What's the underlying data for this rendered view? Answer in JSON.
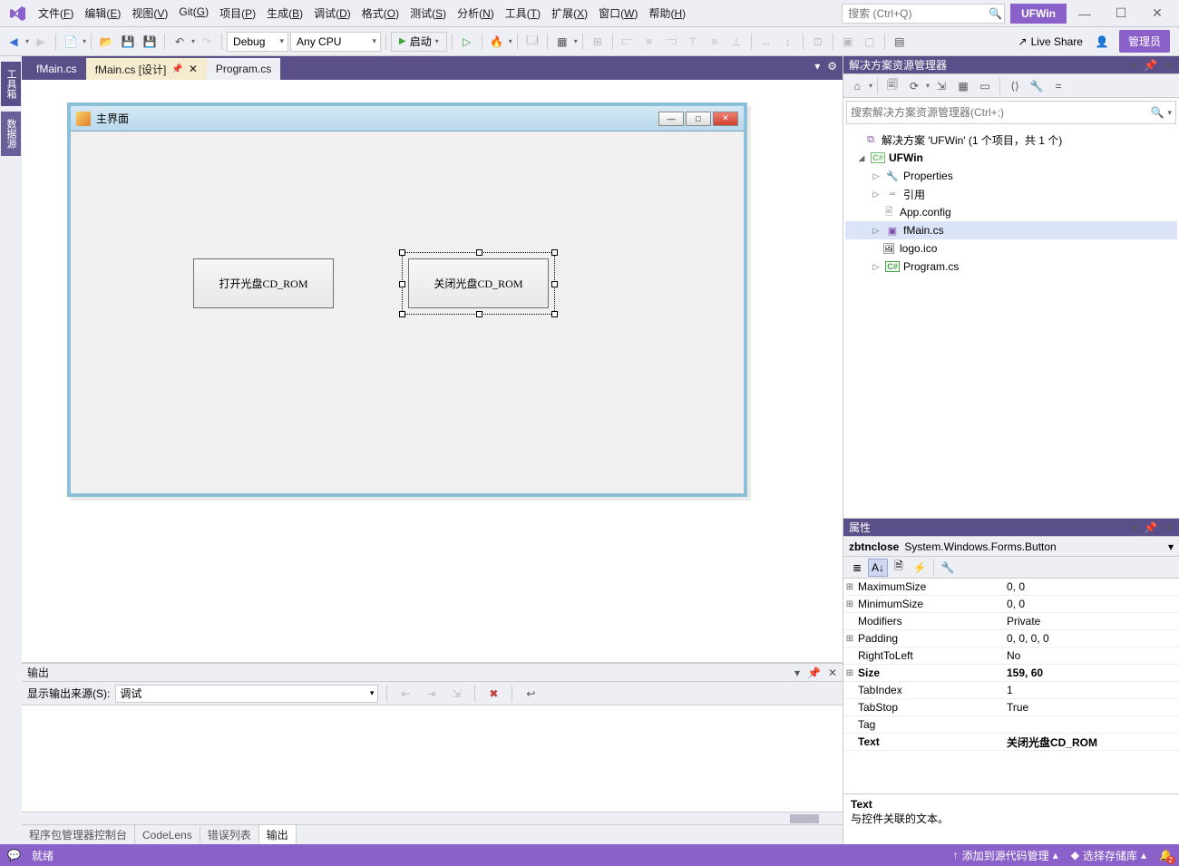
{
  "titlebar": {
    "menus": [
      "文件(F)",
      "编辑(E)",
      "视图(V)",
      "Git(G)",
      "项目(P)",
      "生成(B)",
      "调试(D)",
      "格式(O)",
      "测试(S)",
      "分析(N)",
      "工具(T)",
      "扩展(X)",
      "窗口(W)",
      "帮助(H)"
    ],
    "search_placeholder": "搜索 (Ctrl+Q)",
    "solution_name": "UFWin"
  },
  "toolbar": {
    "config": "Debug",
    "platform": "Any CPU",
    "start_label": "启动",
    "live_share": "Live Share",
    "admin": "管理员"
  },
  "side_tabs": [
    "工具箱",
    "数据源"
  ],
  "doc_tabs": [
    {
      "label": "fMain.cs",
      "active": false
    },
    {
      "label": "fMain.cs [设计]",
      "active": true
    },
    {
      "label": "Program.cs",
      "sub": true
    }
  ],
  "designer": {
    "form_title": "主界面",
    "btn_open": "打开光盘CD_ROM",
    "btn_close": "关闭光盘CD_ROM"
  },
  "output": {
    "title": "输出",
    "source_label": "显示输出来源(S):",
    "source_value": "调试",
    "tabs": [
      "程序包管理器控制台",
      "CodeLens",
      "错误列表",
      "输出"
    ]
  },
  "solution_explorer": {
    "title": "解决方案资源管理器",
    "search_placeholder": "搜索解决方案资源管理器(Ctrl+;)",
    "root": "解决方案 'UFWin' (1 个项目，共 1 个)",
    "project": "UFWin",
    "items": [
      "Properties",
      "引用",
      "App.config",
      "fMain.cs",
      "logo.ico",
      "Program.cs"
    ]
  },
  "properties": {
    "title": "属性",
    "object_name": "zbtnclose",
    "object_type": "System.Windows.Forms.Button",
    "rows": [
      {
        "exp": "⊞",
        "name": "MaximumSize",
        "val": "0, 0"
      },
      {
        "exp": "⊞",
        "name": "MinimumSize",
        "val": "0, 0"
      },
      {
        "exp": "",
        "name": "Modifiers",
        "val": "Private"
      },
      {
        "exp": "⊞",
        "name": "Padding",
        "val": "0, 0, 0, 0"
      },
      {
        "exp": "",
        "name": "RightToLeft",
        "val": "No"
      },
      {
        "exp": "⊞",
        "name": "Size",
        "val": "159, 60",
        "bold": true
      },
      {
        "exp": "",
        "name": "TabIndex",
        "val": "1"
      },
      {
        "exp": "",
        "name": "TabStop",
        "val": "True"
      },
      {
        "exp": "",
        "name": "Tag",
        "val": ""
      },
      {
        "exp": "",
        "name": "Text",
        "val": "关闭光盘CD_ROM",
        "bold": true
      }
    ],
    "desc_title": "Text",
    "desc_body": "与控件关联的文本。"
  },
  "statusbar": {
    "ready": "就绪",
    "git_add": "添加到源代码管理",
    "git_repo": "选择存储库"
  }
}
